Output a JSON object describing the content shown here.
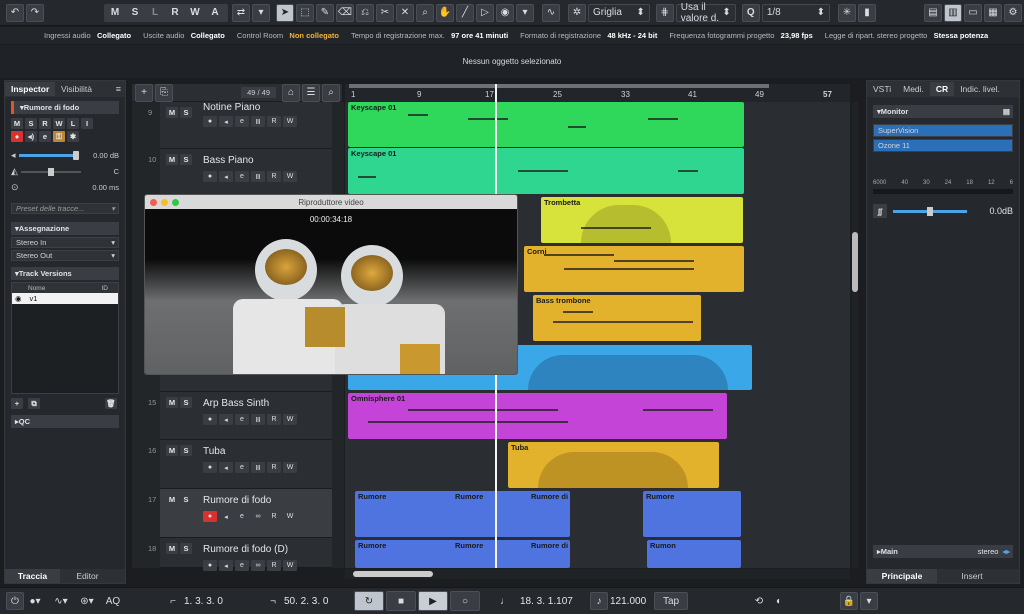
{
  "toolbar": {
    "transport_btns": [
      "M",
      "S",
      "L",
      "R",
      "W",
      "A"
    ],
    "snap_label": "Griglia",
    "quantize_mode": "Usa il valore d.",
    "quantize_value": "1/8",
    "q_label": "Q"
  },
  "status": {
    "items": [
      {
        "label": "Ingressi audio",
        "value": "Collegato"
      },
      {
        "label": "Uscite audio",
        "value": "Collegato"
      },
      {
        "label": "Control Room",
        "value": "Non collegato",
        "warn": true
      },
      {
        "label": "Tempo di registrazione max.",
        "value": "97 ore 41 minuti"
      },
      {
        "label": "Formato di registrazione",
        "value": "48 kHz - 24 bit"
      },
      {
        "label": "Frequenza fotogrammi progetto",
        "value": "23,98 fps"
      },
      {
        "label": "Legge di ripart. stereo progetto",
        "value": "Stessa potenza"
      }
    ],
    "info_line": "Nessun oggetto selezionato"
  },
  "inspector": {
    "tab_inspector": "Inspector",
    "tab_visibility": "Visibilità",
    "track_name": "Rumore di fodo",
    "buttons": [
      "M",
      "S",
      "R",
      "W",
      "L",
      "I"
    ],
    "volume": "0.00 dB",
    "pan": "C",
    "delay": "0.00 ms",
    "preset_placeholder": "Preset delle tracce...",
    "assign_header": "Assegnazione",
    "stereo_in": "Stereo In",
    "stereo_out": "Stereo Out",
    "versions_header": "Track Versions",
    "col_name": "Nome",
    "col_id": "ID",
    "version_v1": "v1",
    "qc_header": "QC",
    "bottom_tab_track": "Traccia",
    "bottom_tab_editor": "Editor"
  },
  "project": {
    "track_count": "49 / 49",
    "ruler": [
      "1",
      "9",
      "17",
      "25",
      "33",
      "41",
      "49",
      "57"
    ]
  },
  "tracks": [
    {
      "num": "9",
      "name": "Notine Piano"
    },
    {
      "num": "10",
      "name": "Bass Piano"
    },
    {
      "num": "15",
      "name": "Arp Bass Sinth"
    },
    {
      "num": "16",
      "name": "Tuba"
    },
    {
      "num": "17",
      "name": "Rumore di fodo"
    },
    {
      "num": "18",
      "name": "Rumore di fodo  (D)"
    }
  ],
  "clips": {
    "keyscape1": "Keyscape 01",
    "keyscape2": "Keyscape 01",
    "trombetta": "Trombetta",
    "corni": "Corni",
    "bass_trombone": "Bass trombone",
    "omnisphere": "Omnisphere 01",
    "tuba": "Tuba",
    "rumore": "Rumore",
    "rumore_di": "Rumore di",
    "rumore_of": "Rumore",
    "rumon": "Rumon"
  },
  "video": {
    "title": "Riproduttore video",
    "timecode": "00:00:34:18"
  },
  "right": {
    "tabs": [
      "VSTi",
      "Medi.",
      "CR",
      "Indic. livel."
    ],
    "monitor_header": "Monitor",
    "sources": [
      "SuperVision",
      "Ozone 11"
    ],
    "meter_scale": [
      "6000",
      "40",
      "30",
      "24",
      "18",
      "12",
      "6"
    ],
    "level": "0.0dB",
    "main_label": "Main",
    "main_value": "stereo",
    "bottom_tab_main": "Principale",
    "bottom_tab_insert": "Insert"
  },
  "transport": {
    "aq": "AQ",
    "left_locator": "1. 3. 3.   0",
    "right_locator": "50. 2. 3.   0",
    "position": "18. 3. 1.107",
    "tempo": "121.000",
    "tap": "Tap"
  },
  "colors": {
    "green": "#2fd85a",
    "teal": "#2ed68f",
    "yellow": "#d7e23a",
    "orange": "#e3b22c",
    "blue": "#3aa7e8",
    "magenta": "#c544d8",
    "audio_blue": "#4f73df"
  }
}
